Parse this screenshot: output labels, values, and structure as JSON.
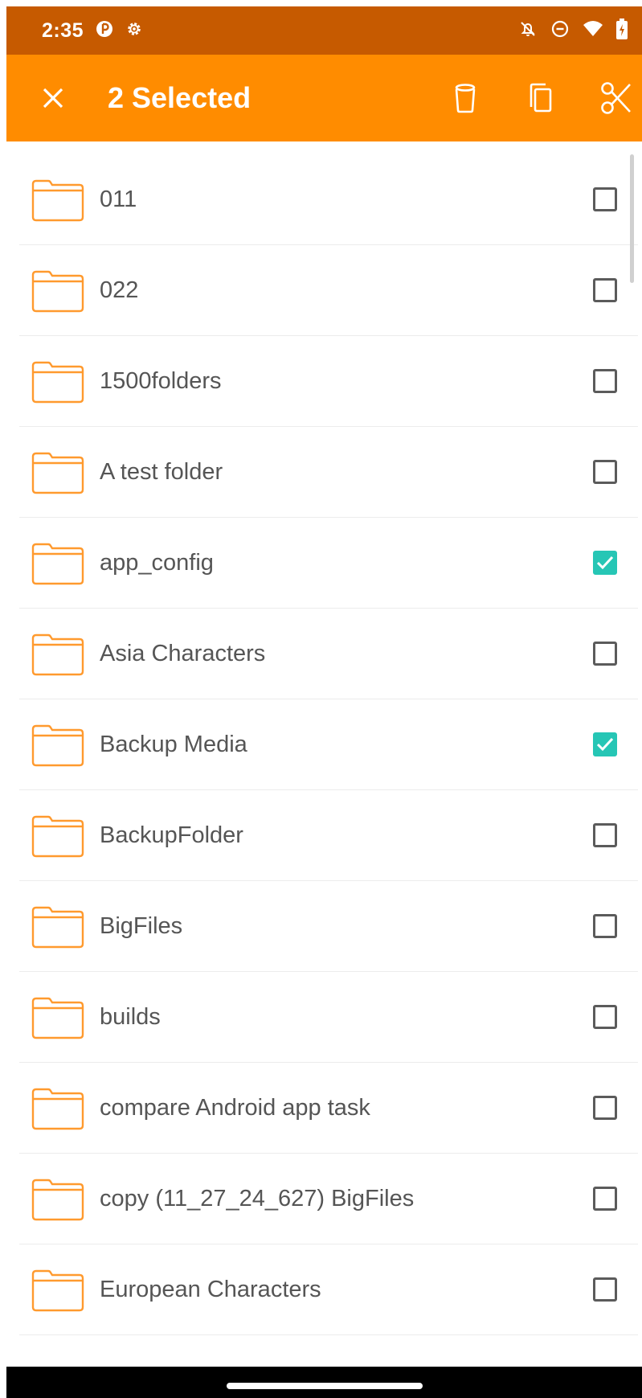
{
  "status_bar": {
    "time": "2:35",
    "left_icons": [
      "notification-app-icon",
      "gear-icon"
    ],
    "right_icons": [
      "bell-off-icon",
      "do-not-disturb-icon",
      "wifi-icon",
      "battery-icon"
    ]
  },
  "toolbar": {
    "title": "2 Selected",
    "close_icon": "close-icon",
    "actions": [
      "trash-icon",
      "copy-icon",
      "scissors-icon"
    ]
  },
  "colors": {
    "status_bar": "#c65a00",
    "toolbar": "#ff8c00",
    "folder_icon": "#ff9a2e",
    "checkbox_checked": "#26c6b5"
  },
  "folders": [
    {
      "name": "011",
      "checked": false
    },
    {
      "name": "022",
      "checked": false
    },
    {
      "name": "1500folders",
      "checked": false
    },
    {
      "name": "A test folder",
      "checked": false
    },
    {
      "name": "app_config",
      "checked": true
    },
    {
      "name": "Asia Characters",
      "checked": false
    },
    {
      "name": "Backup Media",
      "checked": true
    },
    {
      "name": "BackupFolder",
      "checked": false
    },
    {
      "name": "BigFiles",
      "checked": false
    },
    {
      "name": "builds",
      "checked": false
    },
    {
      "name": "compare Android app task",
      "checked": false
    },
    {
      "name": "copy (11_27_24_627) BigFiles",
      "checked": false
    },
    {
      "name": "European Characters",
      "checked": false
    }
  ]
}
